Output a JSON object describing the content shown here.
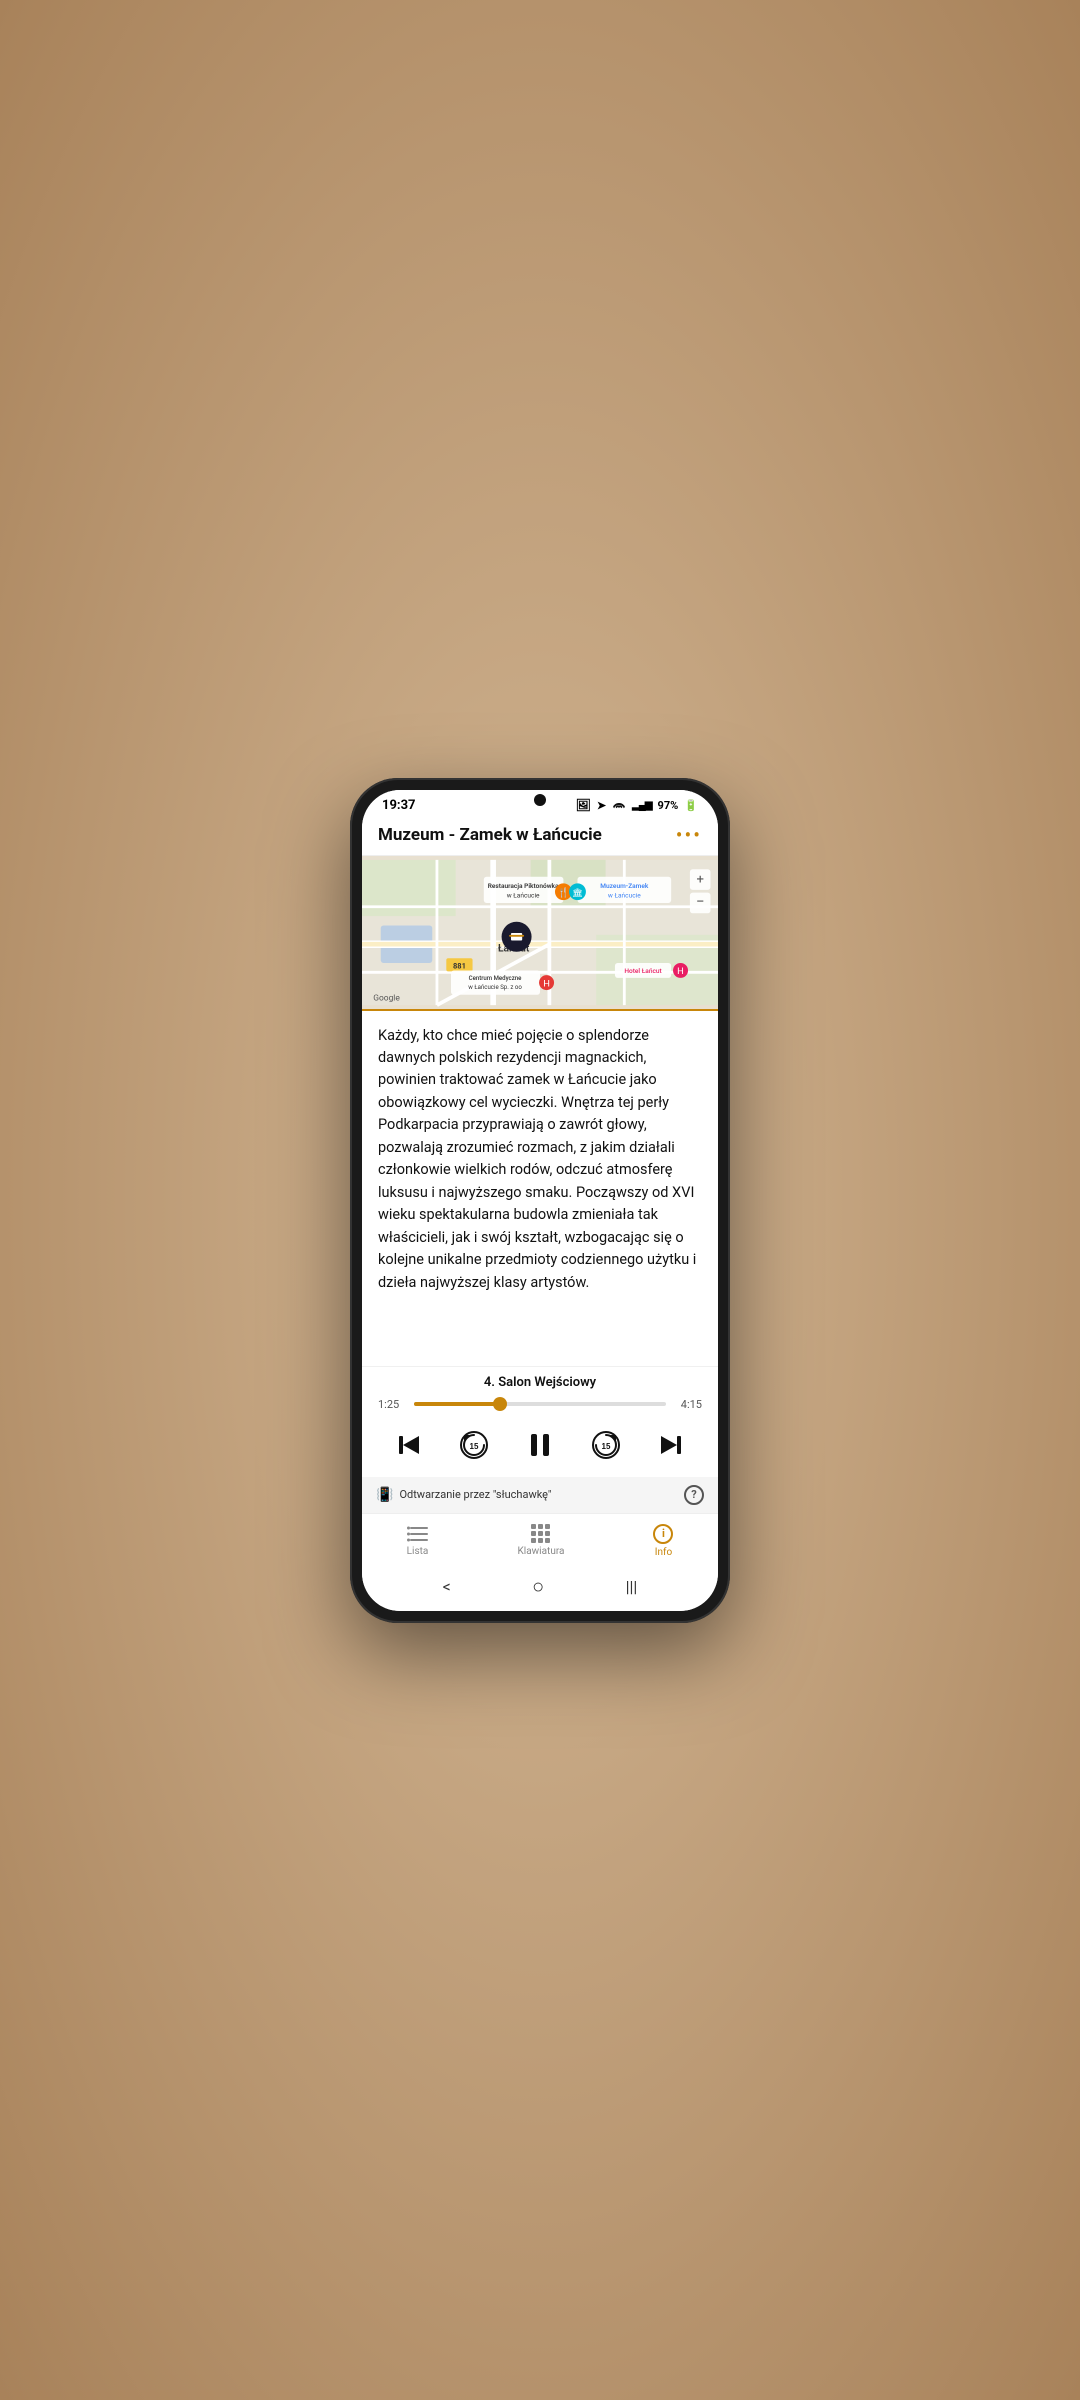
{
  "statusBar": {
    "time": "19:37",
    "battery": "97%",
    "signal": "WiFi"
  },
  "header": {
    "title": "Muzeum - Zamek w Łańcucie",
    "moreIcon": "•••"
  },
  "map": {
    "locations": [
      {
        "name": "Restauracja Piktonówka w Łańcucie",
        "type": "restaurant"
      },
      {
        "name": "Muzeum-Zamek w Łańcucie",
        "type": "museum"
      },
      {
        "name": "Łańcut",
        "type": "city"
      },
      {
        "name": "881",
        "type": "road"
      },
      {
        "name": "Centrum Medyczne w Łańcucie Sp. z oo",
        "type": "medical"
      },
      {
        "name": "Hotel Łańcut",
        "type": "hotel"
      },
      {
        "name": "Google",
        "type": "branding"
      }
    ]
  },
  "description": "Każdy, kto chce mieć pojęcie o splendorze dawnych polskich rezydencji magnackich, powinien traktować zamek w Łańcucie jako obowiązkowy cel wycieczki. Wnętrza tej perły Podkarpacia przyprawiają o zawrót głowy, pozwalają zrozumieć rozmach, z jakim działali członkowie wielkich rodów, odczuć atmosferę luksusu i najwyższego smaku. Począwszy od XVI wieku spektakularna budowla zmieniała tak właścicieli, jak i swój kształt, wzbogacając się o kolejne unikalne przedmioty codziennego użytku i dzieła najwyższej klasy artystów.",
  "player": {
    "trackTitle": "4. Salon Wejściowy",
    "currentTime": "1:25",
    "totalTime": "4:15",
    "progressPercent": 34
  },
  "controls": {
    "prevLabel": "previous",
    "rewindLabel": "15",
    "pauseLabel": "pause",
    "forwardLabel": "15",
    "nextLabel": "next"
  },
  "playbackBar": {
    "deviceText": "Odtwarzanie przez \"słuchawkę\"",
    "helpLabel": "?"
  },
  "bottomNav": {
    "items": [
      {
        "label": "Lista",
        "icon": "list",
        "active": false
      },
      {
        "label": "Klawiatura",
        "icon": "keyboard",
        "active": false
      },
      {
        "label": "Info",
        "icon": "info",
        "active": true
      }
    ]
  },
  "systemNav": {
    "back": "<",
    "home": "○",
    "recent": "|||"
  }
}
